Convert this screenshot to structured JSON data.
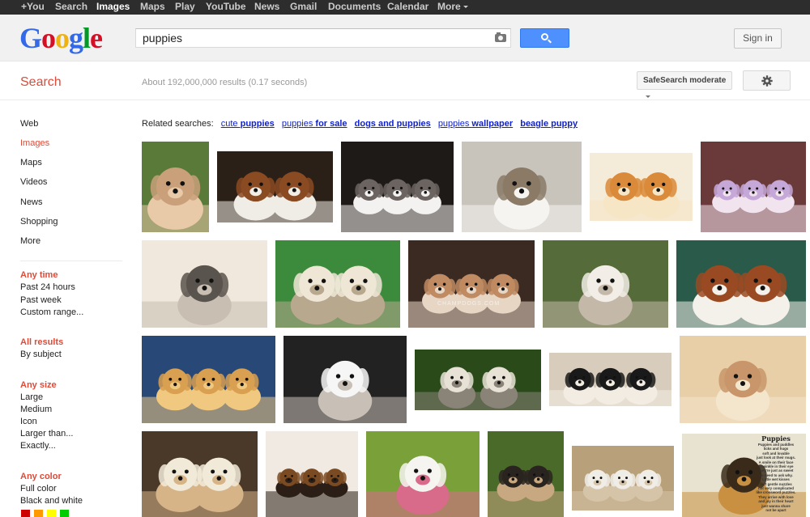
{
  "topbar": {
    "items": [
      "+You",
      "Search",
      "Images",
      "Maps",
      "Play",
      "YouTube",
      "News",
      "Gmail",
      "Documents",
      "Calendar",
      "More"
    ],
    "active_index": 2
  },
  "header": {
    "logo_text": "Google",
    "search_value": "puppies",
    "camera_icon": "camera-icon",
    "search_icon": "search-icon",
    "signin_label": "Sign in"
  },
  "subheader": {
    "title": "Search",
    "stats": "About 192,000,000 results (0.17 seconds)",
    "safesearch_label": "SafeSearch moderate",
    "settings_icon": "gear-icon"
  },
  "leftnav": {
    "items": [
      "Web",
      "Images",
      "Maps",
      "Videos",
      "News",
      "Shopping",
      "More"
    ],
    "active_index": 1
  },
  "tools": {
    "time": {
      "head": "Any time",
      "items": [
        "Past 24 hours",
        "Past week",
        "Custom range..."
      ]
    },
    "results": {
      "head": "All results",
      "items": [
        "By subject"
      ]
    },
    "size": {
      "head": "Any size",
      "items": [
        "Large",
        "Medium",
        "Icon",
        "Larger than...",
        "Exactly..."
      ]
    },
    "color": {
      "head": "Any color",
      "items": [
        "Full color",
        "Black and white"
      ],
      "swatches": [
        "#cc0000",
        "#ff9900",
        "#ffff00",
        "#00cc00"
      ]
    }
  },
  "related": {
    "label": "Related searches:",
    "links": [
      {
        "plain": "cute ",
        "bold": "puppies"
      },
      {
        "plain": "puppies ",
        "bold": "for sale"
      },
      {
        "plain": "",
        "bold": "dogs and puppies"
      },
      {
        "plain": "puppies ",
        "bold": "wallpaper"
      },
      {
        "plain": "",
        "bold": "beagle puppy"
      }
    ]
  },
  "watermark_text": "CHAMPDOGS.COM",
  "book_text": {
    "title": "Puppies",
    "lines": [
      "Puppies and puddles",
      "licks and hugs",
      "soft and lovable",
      "just look at their mugs.",
      "A smile on their face",
      "a twinkle in their eye",
      "they're just as sweet",
      "no need to ask why.",
      "Little wet kisses",
      "soft gentle nuzzles",
      "not very complicated",
      "like crossword puzzles.",
      "They arrive with love",
      "and joy in their heart",
      "just wanna share",
      "not be apart"
    ]
  },
  "images": [
    {
      "name": "puppy-in-hand",
      "colors": [
        "#5a7a3a",
        "#c9a07a",
        "#e8c9a8"
      ]
    },
    {
      "name": "two-cavalier-puppies",
      "colors": [
        "#2b2018",
        "#8a4a22",
        "#f0ece6"
      ]
    },
    {
      "name": "two-husky-puppies",
      "colors": [
        "#1e1a18",
        "#6b6460",
        "#f4f2f0"
      ]
    },
    {
      "name": "two-white-puppies-running",
      "colors": [
        "#c8c4bc",
        "#8a7a66",
        "#f6f4f0"
      ]
    },
    {
      "name": "golden-puppies-cuddling",
      "colors": [
        "#f4ecd8",
        "#d98a3a",
        "#f7e6c6"
      ]
    },
    {
      "name": "puppies-in-clothes",
      "colors": [
        "#6a3a3a",
        "#c6a8d8",
        "#f2e4ee"
      ]
    },
    {
      "name": "husky-puppies-kissing",
      "colors": [
        "#f0e8dc",
        "#5a544e",
        "#c8beb2"
      ]
    },
    {
      "name": "white-puppy-green-bg",
      "colors": [
        "#3c8a3c",
        "#efe6d6",
        "#b8a88e"
      ]
    },
    {
      "name": "bulldog-puppy",
      "colors": [
        "#3a2a22",
        "#c08a62",
        "#e8d6c4"
      ]
    },
    {
      "name": "fluffy-white-puppies",
      "colors": [
        "#556b3a",
        "#f2ede6",
        "#c4b8a8"
      ]
    },
    {
      "name": "cavalier-puppies-blanket",
      "colors": [
        "#2a5a4a",
        "#9a4a22",
        "#f4f0ea"
      ]
    },
    {
      "name": "golden-retriever-litter",
      "colors": [
        "#284878",
        "#d8a050",
        "#f0c880"
      ]
    },
    {
      "name": "white-fluffy-puppy-closeup",
      "colors": [
        "#222222",
        "#f6f6f6",
        "#c8c0b6"
      ]
    },
    {
      "name": "puppy-litter-grass",
      "colors": [
        "#2a4a1a",
        "#e8e2d6",
        "#8a8478"
      ]
    },
    {
      "name": "black-white-puppy-litter",
      "colors": [
        "#d8ccbc",
        "#1a1a1a",
        "#f2ece2"
      ]
    },
    {
      "name": "sleeping-yellow-puppies",
      "colors": [
        "#e8cfa8",
        "#c8966a",
        "#f4e6cc"
      ]
    },
    {
      "name": "two-golden-puppies",
      "colors": [
        "#4a3828",
        "#f2ead8",
        "#d6b488"
      ]
    },
    {
      "name": "beagle-puppy",
      "colors": [
        "#f0eae2",
        "#7a4a22",
        "#2a1e16"
      ]
    },
    {
      "name": "white-puppies-basket",
      "colors": [
        "#7aa03a",
        "#f6f4f0",
        "#d86a8a"
      ]
    },
    {
      "name": "pug-puppy",
      "colors": [
        "#4a6a2a",
        "#2a2420",
        "#c8a880"
      ]
    },
    {
      "name": "sleeping-puppies-circle",
      "colors": [
        "#b8a07a",
        "#f0ece6",
        "#d6c4a8"
      ]
    },
    {
      "name": "yorkie-puppy-poem",
      "colors": [
        "#e8e2d0",
        "#3a2a1a",
        "#c89040"
      ]
    }
  ]
}
